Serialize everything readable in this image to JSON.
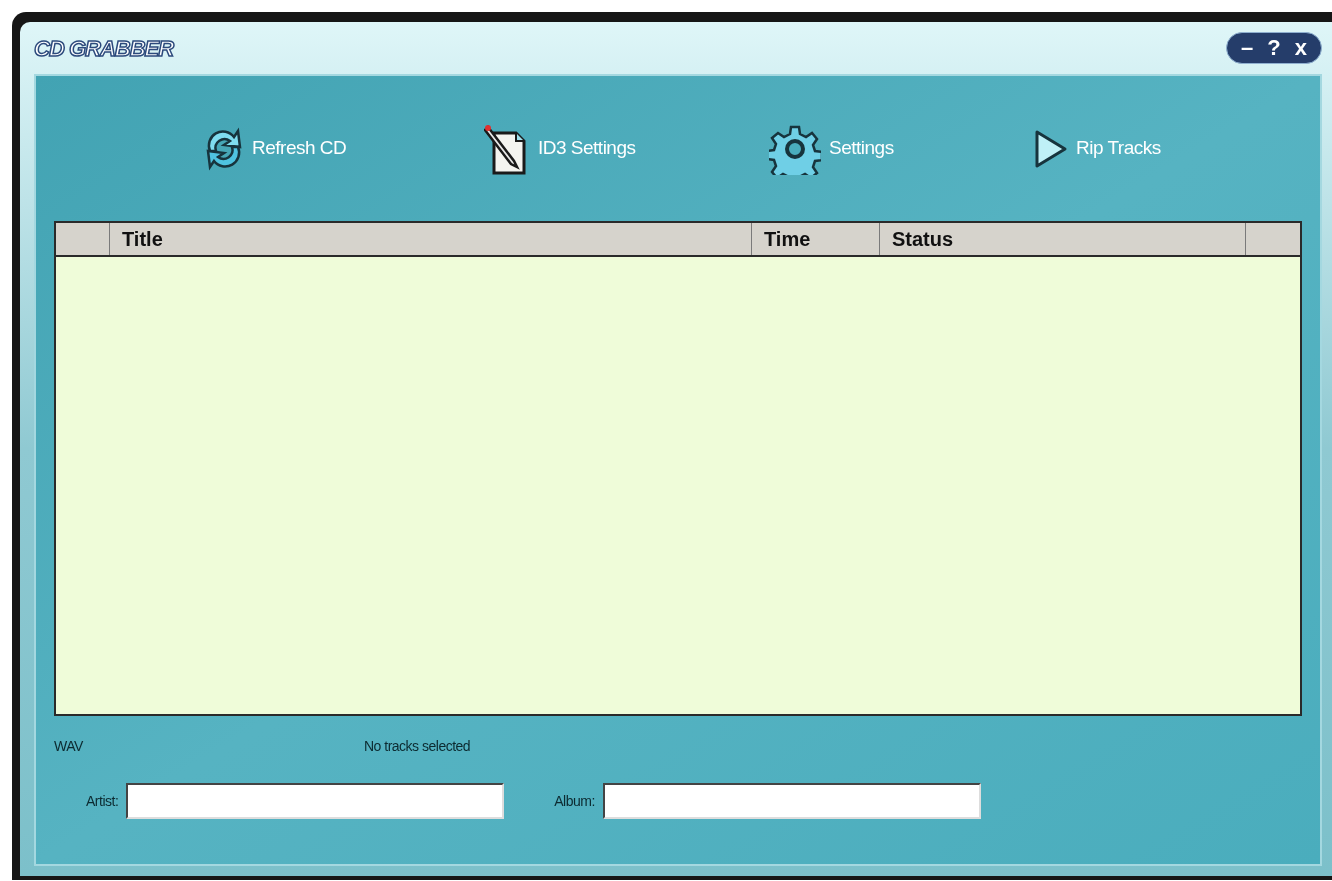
{
  "window": {
    "title": "CD GRABBER",
    "controls": [
      "–",
      "?",
      "x"
    ]
  },
  "toolbar": [
    {
      "kind": "refresh",
      "label": "Refresh CD"
    },
    {
      "kind": "tag",
      "label": "ID3 Settings"
    },
    {
      "kind": "gear",
      "label": "Settings"
    },
    {
      "kind": "play",
      "label": "Rip Tracks"
    }
  ],
  "table": {
    "columns": [
      "Title",
      "Time",
      "Status"
    ]
  },
  "status_bar": {
    "format": "WAV",
    "selection": "No tracks selected"
  },
  "fields": [
    {
      "label": "Artist:"
    },
    {
      "label": "Album:"
    }
  ]
}
